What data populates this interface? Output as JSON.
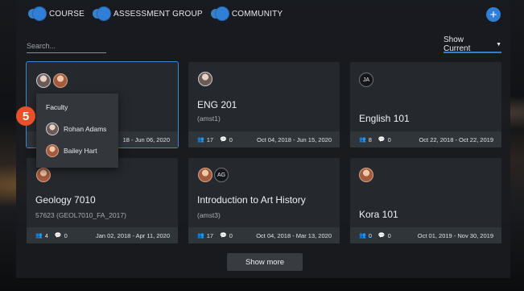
{
  "filters": {
    "toggles": [
      {
        "label": "COURSE"
      },
      {
        "label": "ASSESSMENT GROUP"
      },
      {
        "label": "COMMUNITY"
      }
    ],
    "add_label": "+"
  },
  "search": {
    "placeholder": "Search..."
  },
  "view_select": {
    "label": "Show Current"
  },
  "cards": [
    {
      "title": "",
      "subtitle": "",
      "members": "",
      "comments": "",
      "dates": "18 - Jun 06, 2020"
    },
    {
      "title": "ENG 201",
      "subtitle": "(amst1)",
      "members": "17",
      "comments": "0",
      "dates": "Oct 04, 2018 - Jun 15, 2020"
    },
    {
      "title": "English 101",
      "subtitle": "",
      "initials": "JA",
      "members": "8",
      "comments": "0",
      "dates": "Oct 22, 2018 - Oct 22, 2019"
    },
    {
      "title": "Geology 7010",
      "subtitle": "57623 (GEOL7010_FA_2017)",
      "members": "4",
      "comments": "0",
      "dates": "Jan 02, 2018 - Apr 11, 2020"
    },
    {
      "title": "Introduction to Art History",
      "subtitle": "(amst3)",
      "initials": "AG",
      "members": "17",
      "comments": "0",
      "dates": "Oct 04, 2018 - Mar 13, 2020"
    },
    {
      "title": "Kora 101",
      "subtitle": "",
      "members": "0",
      "comments": "0",
      "dates": "Oct 01, 2019 - Nov 30, 2019"
    }
  ],
  "popover": {
    "header": "Faculty",
    "items": [
      {
        "name": "Rohan Adams"
      },
      {
        "name": "Bailey Hart"
      }
    ]
  },
  "step_badge": "5",
  "show_more": "Show more"
}
